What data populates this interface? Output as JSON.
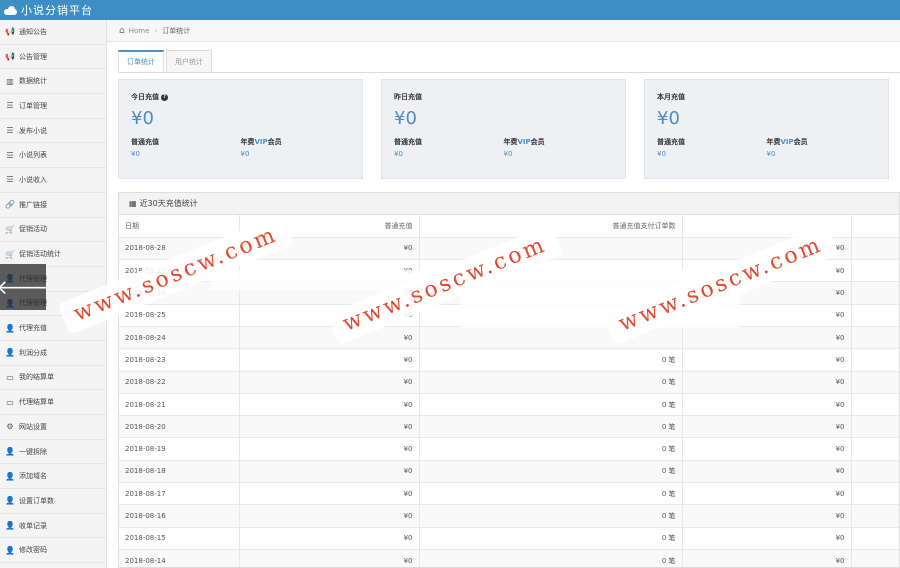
{
  "app": {
    "title": "小说分销平台"
  },
  "sidebar": {
    "items": [
      {
        "label": "通知公告",
        "icon": "megaphone-icon",
        "glyph": "📢"
      },
      {
        "label": "公告管理",
        "icon": "megaphone-icon",
        "glyph": "📢"
      },
      {
        "label": "数据统计",
        "icon": "bar-chart-icon",
        "glyph": "▥"
      },
      {
        "label": "订单管理",
        "icon": "list-icon",
        "glyph": "☰"
      },
      {
        "label": "发布小说",
        "icon": "list-icon",
        "glyph": "☰"
      },
      {
        "label": "小说列表",
        "icon": "list-icon",
        "glyph": "☰"
      },
      {
        "label": "小说收入",
        "icon": "list-icon",
        "glyph": "☰"
      },
      {
        "label": "推广链接",
        "icon": "link-icon",
        "glyph": "🔗"
      },
      {
        "label": "促销活动",
        "icon": "cart-icon",
        "glyph": "🛒"
      },
      {
        "label": "促销活动统计",
        "icon": "cart-icon",
        "glyph": "🛒"
      },
      {
        "label": "代理管理",
        "icon": "user-icon",
        "glyph": "👤"
      },
      {
        "label": "代理管理",
        "icon": "user-icon",
        "glyph": "👤"
      },
      {
        "label": "代理充值",
        "icon": "user-plus-icon",
        "glyph": "👤"
      },
      {
        "label": "利润分成",
        "icon": "user-plus-icon",
        "glyph": "👤"
      },
      {
        "label": "我的结算单",
        "icon": "file-icon",
        "glyph": "▭"
      },
      {
        "label": "代理结算单",
        "icon": "file-icon",
        "glyph": "▭"
      },
      {
        "label": "网站设置",
        "icon": "gears-icon",
        "glyph": "⚙"
      },
      {
        "label": "一键拆除",
        "icon": "user-plus-icon",
        "glyph": "👤"
      },
      {
        "label": "添加域名",
        "icon": "user-plus-icon",
        "glyph": "👤"
      },
      {
        "label": "设置订单数",
        "icon": "user-plus-icon",
        "glyph": "👤"
      },
      {
        "label": "收单记录",
        "icon": "user-plus-icon",
        "glyph": "👤"
      },
      {
        "label": "修改密码",
        "icon": "user-plus-icon",
        "glyph": "👤"
      }
    ]
  },
  "back_button": {
    "glyph": "🡐"
  },
  "breadcrumb": {
    "home": "Home",
    "sep": "›",
    "current": "订单统计"
  },
  "tabs": [
    {
      "label": "订单统计"
    },
    {
      "label": "用户统计"
    }
  ],
  "cards": [
    {
      "label": "今日充值",
      "value": "¥0",
      "sub1_label": "普通充值",
      "sub1_value": "¥0",
      "sub2_pre": "年费",
      "sub2_vip": "VIP",
      "sub2_post": "会员",
      "sub2_value": "¥0"
    },
    {
      "label": "昨日充值",
      "value": "¥0",
      "sub1_label": "普通充值",
      "sub1_value": "¥0",
      "sub2_pre": "年费",
      "sub2_vip": "VIP",
      "sub2_post": "会员",
      "sub2_value": "¥0"
    },
    {
      "label": "本月充值",
      "value": "¥0",
      "sub1_label": "普通充值",
      "sub1_value": "¥0",
      "sub2_pre": "年费",
      "sub2_vip": "VIP",
      "sub2_post": "会员",
      "sub2_value": "¥0"
    }
  ],
  "panel": {
    "title": "近30天充值统计",
    "columns": [
      "日期",
      "普通充值",
      "普通充值支付订单数",
      "",
      ""
    ],
    "rows": [
      [
        "2018-08-28",
        "¥0",
        "",
        "¥0"
      ],
      [
        "2018-08-27",
        "¥0",
        "",
        "¥0"
      ],
      [
        "2018-08-26",
        "¥0",
        "",
        "¥0"
      ],
      [
        "2018-08-25",
        "¥0",
        "",
        "¥0"
      ],
      [
        "2018-08-24",
        "¥0",
        "",
        "¥0"
      ],
      [
        "2018-08-23",
        "¥0",
        "0 笔",
        "¥0"
      ],
      [
        "2018-08-22",
        "¥0",
        "0 笔",
        "¥0"
      ],
      [
        "2018-08-21",
        "¥0",
        "0 笔",
        "¥0"
      ],
      [
        "2018-08-20",
        "¥0",
        "0 笔",
        "¥0"
      ],
      [
        "2018-08-19",
        "¥0",
        "0 笔",
        "¥0"
      ],
      [
        "2018-08-18",
        "¥0",
        "0 笔",
        "¥0"
      ],
      [
        "2018-08-17",
        "¥0",
        "0 笔",
        "¥0"
      ],
      [
        "2018-08-16",
        "¥0",
        "0 笔",
        "¥0"
      ],
      [
        "2018-08-15",
        "¥0",
        "0 笔",
        "¥0"
      ],
      [
        "2018-08-14",
        "¥0",
        "0 笔",
        "¥0"
      ]
    ]
  },
  "watermark": {
    "text": "www.soscw.com"
  },
  "colors": {
    "topbar": "#3b8fc4",
    "accent": "#4a8fc9",
    "watermark": "#e2492d"
  }
}
